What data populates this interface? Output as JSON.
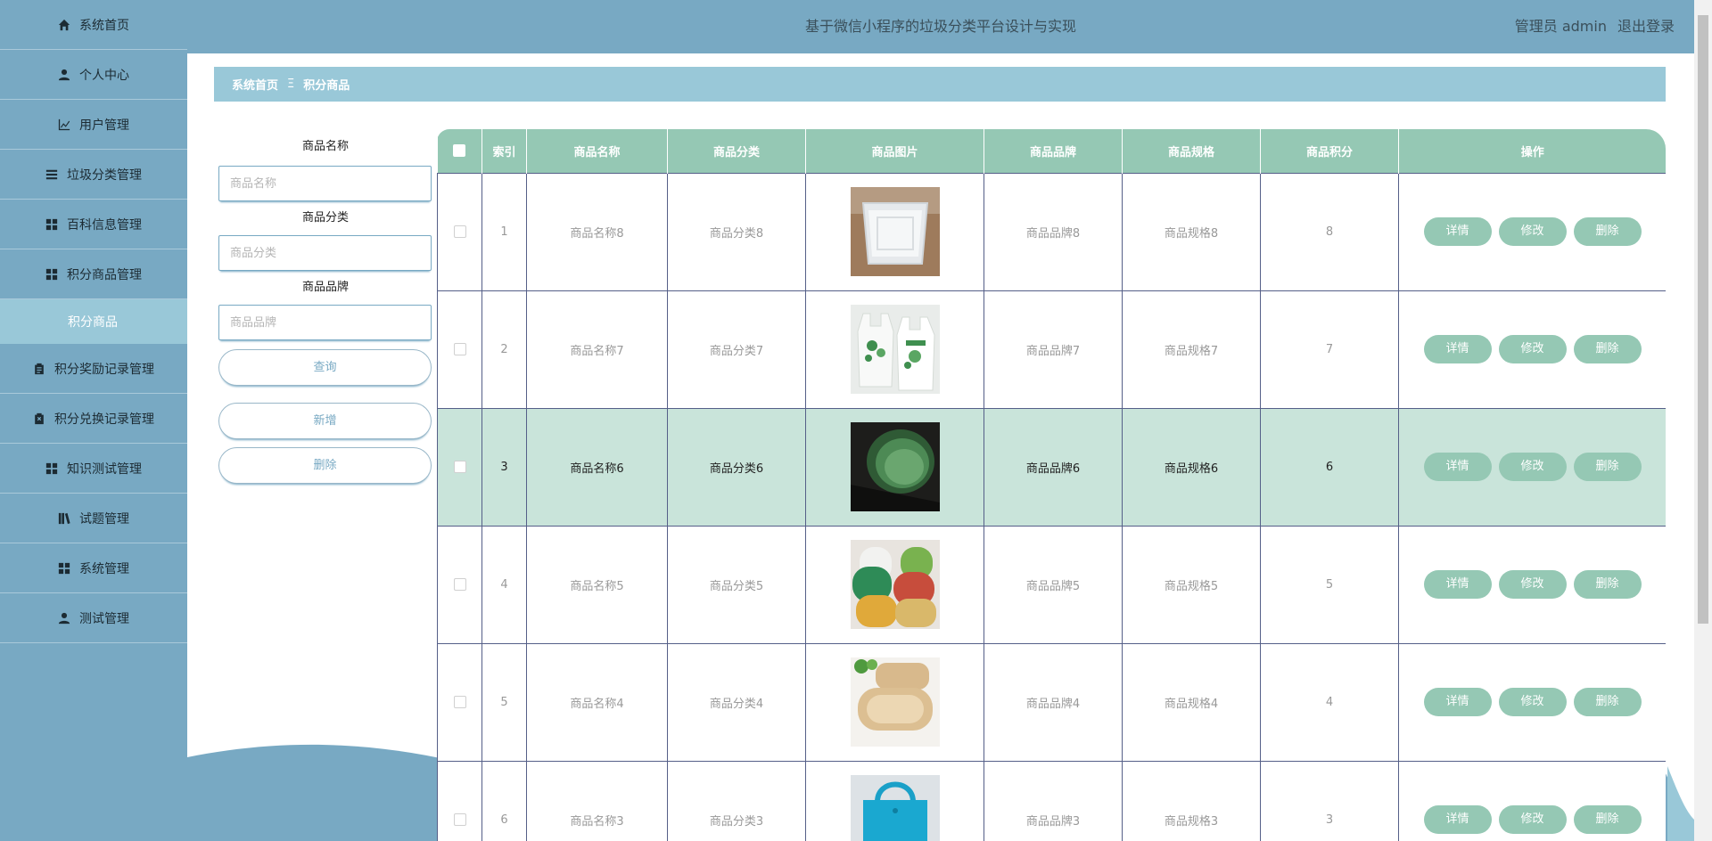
{
  "sidebar": {
    "items": [
      {
        "label": "系统首页",
        "icon": "home-icon"
      },
      {
        "label": "个人中心",
        "icon": "user-icon"
      },
      {
        "label": "用户管理",
        "icon": "chart-icon"
      },
      {
        "label": "垃圾分类管理",
        "icon": "list-icon"
      },
      {
        "label": "百科信息管理",
        "icon": "grid-icon"
      },
      {
        "label": "积分商品管理",
        "icon": "grid-icon"
      },
      {
        "label": "积分商品",
        "icon": ""
      },
      {
        "label": "积分奖励记录管理",
        "icon": "clipboard-icon"
      },
      {
        "label": "积分兑换记录管理",
        "icon": "clipboard-x-icon"
      },
      {
        "label": "知识测试管理",
        "icon": "grid-icon"
      },
      {
        "label": "试题管理",
        "icon": "book-icon"
      },
      {
        "label": "系统管理",
        "icon": "grid-icon"
      },
      {
        "label": "测试管理",
        "icon": "user-icon"
      }
    ]
  },
  "header": {
    "title": "基于微信小程序的垃圾分类平台设计与实现",
    "user": "管理员 admin",
    "logout": "退出登录"
  },
  "breadcrumb": {
    "home": "系统首页",
    "sep": "Ξ",
    "current": "积分商品"
  },
  "search": {
    "name_label": "商品名称",
    "name_placeholder": "商品名称",
    "category_label": "商品分类",
    "category_placeholder": "商品分类",
    "brand_label": "商品品牌",
    "brand_placeholder": "商品品牌",
    "query_btn": "查询",
    "add_btn": "新增",
    "delete_btn": "删除"
  },
  "table": {
    "headers": [
      "索引",
      "商品名称",
      "商品分类",
      "商品图片",
      "商品品牌",
      "商品规格",
      "商品积分",
      "操作"
    ],
    "actions": {
      "detail": "详情",
      "edit": "修改",
      "delete": "删除"
    },
    "rows": [
      {
        "index": "1",
        "name": "商品名称8",
        "category": "商品分类8",
        "brand": "商品品牌8",
        "spec": "商品规格8",
        "points": "8",
        "image": "plastic-container-image"
      },
      {
        "index": "2",
        "name": "商品名称7",
        "category": "商品分类7",
        "brand": "商品品牌7",
        "spec": "商品规格7",
        "points": "7",
        "image": "plastic-bags-image"
      },
      {
        "index": "3",
        "name": "商品名称6",
        "category": "商品分类6",
        "brand": "商品品牌6",
        "spec": "商品规格6",
        "points": "6",
        "image": "green-bucket-image"
      },
      {
        "index": "4",
        "name": "商品名称5",
        "category": "商品分类5",
        "brand": "商品品牌5",
        "spec": "商品规格5",
        "points": "5",
        "image": "towel-rolls-image"
      },
      {
        "index": "5",
        "name": "商品名称4",
        "category": "商品分类4",
        "brand": "商品品牌4",
        "spec": "商品规格4",
        "points": "4",
        "image": "lunch-box-image"
      },
      {
        "index": "6",
        "name": "商品名称3",
        "category": "商品分类3",
        "brand": "商品品牌3",
        "spec": "商品规格3",
        "points": "3",
        "image": "tote-bag-image"
      }
    ]
  },
  "colors": {
    "sidebar_bg": "#78a9c3",
    "header_bg": "#78a9c3",
    "breadcrumb_bg": "#99c8d8",
    "table_header_bg": "#95c8b4",
    "highlight_row_bg": "#c9e4da",
    "action_btn_bg": "#95c8b4"
  }
}
